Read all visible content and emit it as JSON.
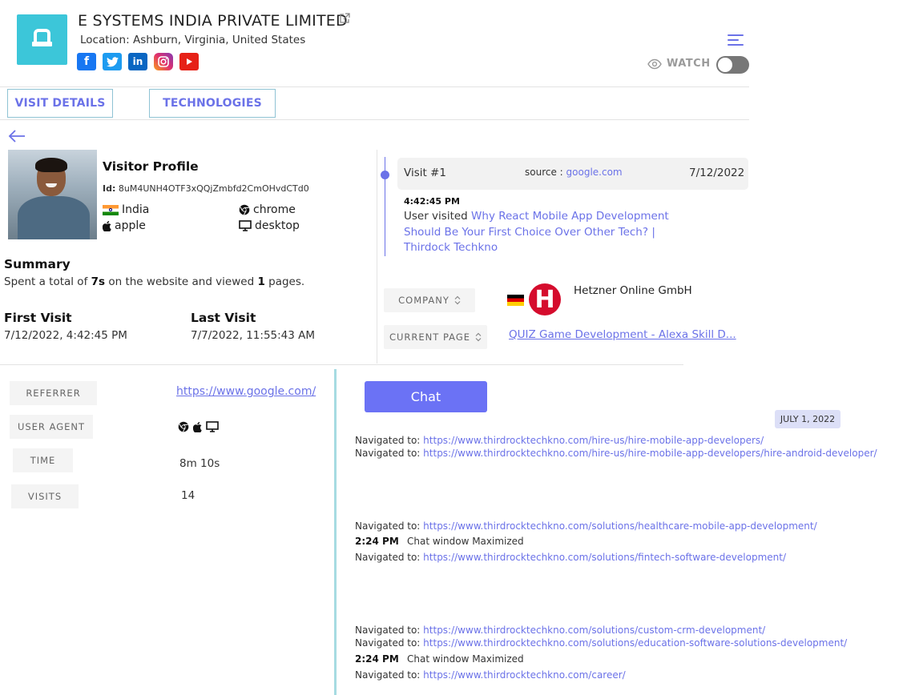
{
  "header": {
    "company_name": "E SYSTEMS INDIA PRIVATE LIMITED",
    "location_label": "Location:",
    "location_value": "Ashburn, Virginia, United States",
    "socials": [
      "facebook-icon",
      "twitter-icon",
      "linkedin-icon",
      "instagram-icon",
      "youtube-icon"
    ],
    "watch_label": "WATCH",
    "watch_on": false
  },
  "tabs": [
    {
      "label": "VISIT DETAILS"
    },
    {
      "label": "TECHNOLOGIES"
    }
  ],
  "profile": {
    "title": "Visitor Profile",
    "id_label": "Id:",
    "id_value": "8uM4UNH4OTF3xQQjZmbfd2CmOHvdCTd0",
    "country": "India",
    "browser": "chrome",
    "os": "apple",
    "device": "desktop"
  },
  "summary": {
    "title": "Summary",
    "text_pre": "Spent a total of ",
    "time": "7s",
    "text_mid": " on the website and viewed ",
    "pages": "1",
    "text_post": " pages."
  },
  "first_visit": {
    "title": "First Visit",
    "value": "7/12/2022, 4:42:45 PM"
  },
  "last_visit": {
    "title": "Last Visit",
    "value": "7/7/2022, 11:55:43 AM"
  },
  "visit": {
    "number": "Visit #1",
    "source_label": "source : ",
    "source_value": "google.com",
    "date": "7/12/2022",
    "time": "4:42:45 PM",
    "desc_prefix": "User visited ",
    "page_title": "Why React Mobile App Development Should Be Your First Choice Over Other Tech? | Thirdock Techkno"
  },
  "company_row": {
    "label": "COMPANY",
    "value": "Hetzner Online GmbH",
    "logo_letter": "H"
  },
  "current_page_row": {
    "label": "CURRENT PAGE",
    "value": "QUIZ Game Development - Alexa Skill D..."
  },
  "details": {
    "referrer_label": "REFERRER",
    "referrer_value": "https://www.google.com/",
    "user_agent_label": "USER AGENT",
    "time_label": "TIME",
    "time_value": "8m 10s",
    "visits_label": "VISITS",
    "visits_value": "14"
  },
  "chat": {
    "button_label": "Chat",
    "date_badge": "JULY 1, 2022",
    "nav_label": "Navigated to: ",
    "logs": [
      {
        "url": "https://www.thirdrocktechkno.com/hire-us/hire-mobile-app-developers/"
      },
      {
        "url": "https://www.thirdrocktechkno.com/hire-us/hire-mobile-app-developers/hire-android-developer/"
      },
      {
        "url": "https://www.thirdrocktechkno.com/solutions/healthcare-mobile-app-development/"
      },
      {
        "url": "https://www.thirdrocktechkno.com/solutions/fintech-software-development/"
      },
      {
        "url": "https://www.thirdrocktechkno.com/solutions/custom-crm-development/"
      },
      {
        "url": "https://www.thirdrocktechkno.com/solutions/education-software-solutions-development/"
      },
      {
        "url": "https://www.thirdrocktechkno.com/career/"
      }
    ],
    "events": [
      {
        "time": "2:24 PM",
        "text": "Chat window Maximized"
      },
      {
        "time": "2:24 PM",
        "text": "Chat window Maximized"
      }
    ]
  },
  "colors": {
    "accent": "#6b72e8",
    "logo_bg": "#3cc6d9",
    "chat_button": "#6b72f5",
    "teal_divider": "#a6dbe2"
  }
}
